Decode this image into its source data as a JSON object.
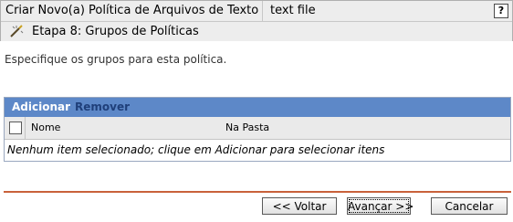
{
  "header": {
    "title": "Criar Novo(a) Política de Arquivos de Texto",
    "object_name": "text file",
    "help_label": "?",
    "step_label": "Etapa 8: Grupos de Políticas"
  },
  "instructions": "Especifique os grupos para esta política.",
  "table": {
    "toolbar": {
      "add_label": "Adicionar",
      "remove_label": "Remover"
    },
    "columns": [
      "Nome",
      "Na Pasta"
    ],
    "empty_message": "Nenhum item selecionado; clique em Adicionar para selecionar itens"
  },
  "buttons": {
    "back": "<< Voltar",
    "next": "Avançar >>",
    "cancel": "Cancelar"
  },
  "colors": {
    "toolbar_bg": "#5d88c8",
    "divider": "#c9623b",
    "header_bg": "#ededed"
  }
}
